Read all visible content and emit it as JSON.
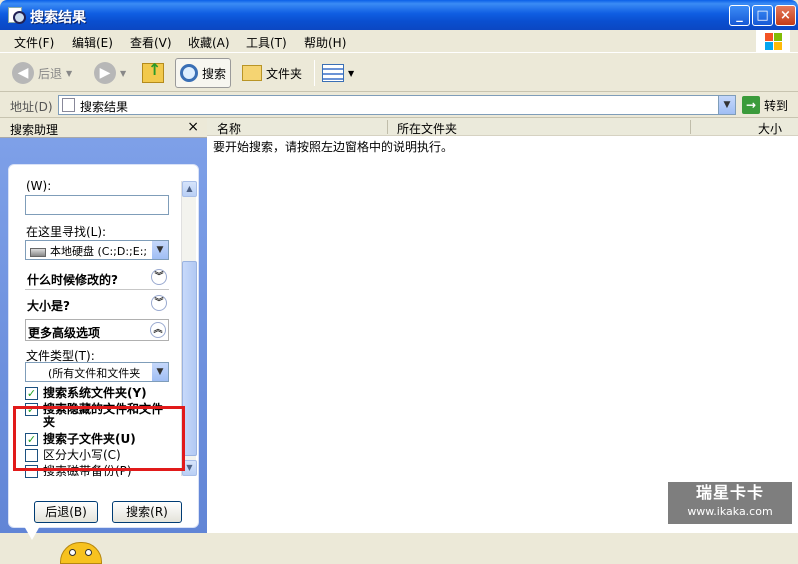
{
  "window": {
    "title": "搜索结果"
  },
  "menu": [
    "文件(F)",
    "编辑(E)",
    "查看(V)",
    "收藏(A)",
    "工具(T)",
    "帮助(H)"
  ],
  "toolbar": {
    "back": "后退",
    "search": "搜索",
    "folders": "文件夹"
  },
  "address": {
    "label": "地址(D)",
    "value": "搜索结果",
    "go": "转到"
  },
  "assistant": {
    "title": "搜索助理",
    "close": "×",
    "word_label": "(W):",
    "word_value": "",
    "look_in_label": "在这里寻找(L):",
    "look_in_value": "本地硬盘 (C:;D:;E:;F",
    "when_modified": "什么时候修改的?",
    "size": "大小是?",
    "advanced": "更多高级选项",
    "file_type_label": "文件类型(T):",
    "file_type_value": "(所有文件和文件夹",
    "options": [
      {
        "label": "搜索系统文件夹(Y)",
        "checked": true
      },
      {
        "label": "搜索隐藏的文件和文件夹",
        "checked": true
      },
      {
        "label": "搜索子文件夹(U)",
        "checked": true
      },
      {
        "label": "区分大小写(C)",
        "checked": false
      },
      {
        "label": "搜索磁带备份(P)",
        "checked": false
      }
    ],
    "back_button": "后退(B)",
    "search_button": "搜索(R)"
  },
  "results": {
    "columns": [
      "名称",
      "所在文件夹",
      "大小"
    ],
    "hint": "要开始搜索，请按照左边窗格中的说明执行。"
  },
  "watermark": {
    "main": "瑞星卡卡",
    "url": "www.ikaka.com"
  },
  "colors": {
    "title_blue": "#0a5fe8",
    "pane_blue": "#6a8bd8",
    "highlight_red": "#e11a1a"
  }
}
